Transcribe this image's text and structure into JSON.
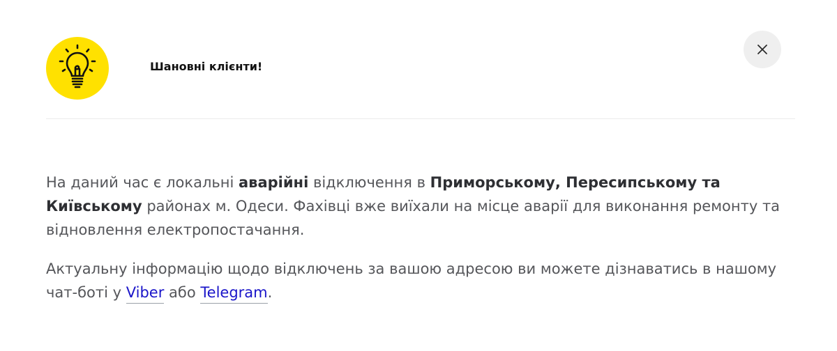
{
  "modal": {
    "title": "Шановні клієнти!",
    "icon": "lightbulb-icon",
    "close_icon": "close-icon",
    "colors": {
      "badge": "#ffe100",
      "link": "#1a15c9",
      "close_bg": "#efefef",
      "text": "#55565a"
    }
  },
  "body": {
    "p1": {
      "t1": "На даний час є локальні ",
      "b1": "аварійні",
      "t2": " відключення в ",
      "b2": "Приморському, Пересипському та Київському",
      "t3": " районах м. Одеси. Фахівці вже виїхали на місце аварії для виконання ремонту та відновлення електропостачання."
    },
    "p2": {
      "t1": "Актуальну інформацію щодо відключень за вашою адресою ви можете дізнаватись в нашому чат-боті у ",
      "link_viber": "Viber",
      "t2": " або ",
      "link_telegram": "Telegram",
      "t3": "."
    }
  }
}
